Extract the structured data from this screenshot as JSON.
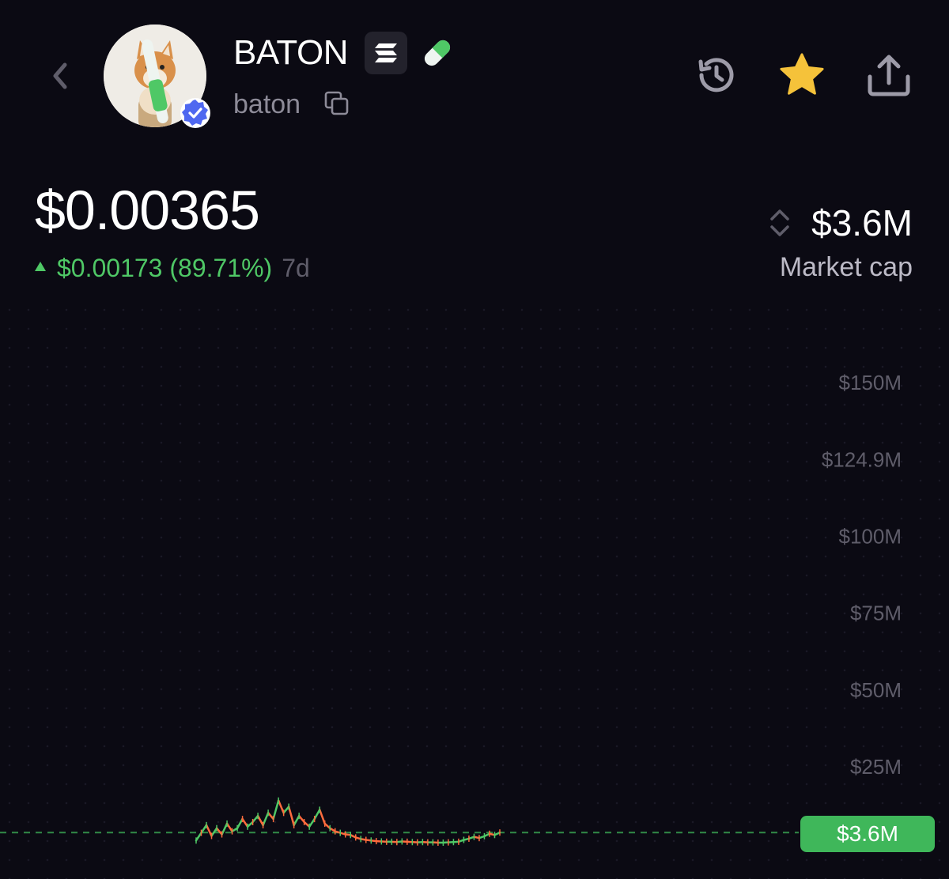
{
  "header": {
    "token_name": "BATON",
    "token_symbol": "baton",
    "icons": {
      "back": "chevron-left-icon",
      "chain": "solana-icon",
      "pill": "pill-icon",
      "copy": "copy-icon",
      "history": "history-icon",
      "watchlist": "star-icon",
      "share": "share-icon",
      "verified": "verified-badge-icon"
    },
    "watchlist_color": "#f5c23a"
  },
  "price": {
    "value": "$0.00365",
    "change": "$0.00173 (89.71%)",
    "period": "7d",
    "change_direction": "up",
    "change_color": "#4fc866"
  },
  "market_cap": {
    "value": "$3.6M",
    "label": "Market cap"
  },
  "chart": {
    "current_label": "$3.6M",
    "current_color": "#3fb75a"
  },
  "chart_data": {
    "type": "line",
    "title": "",
    "xlabel": "",
    "ylabel": "",
    "y_ticks": [
      "$150M",
      "$124.9M",
      "$100M",
      "$75M",
      "$50M",
      "$25M"
    ],
    "ylim": [
      0,
      150
    ],
    "y_unit": "M USD",
    "current_value": 3.6,
    "series": [
      {
        "values": [
          1,
          3.5,
          6,
          2.5,
          5,
          3,
          6.5,
          4,
          5,
          8,
          5.5,
          7,
          9,
          6,
          10,
          8,
          14,
          10,
          12,
          6,
          9,
          7,
          5.5,
          8,
          11,
          6.5,
          5,
          4,
          3.5,
          3,
          2.8,
          2,
          1.5,
          1.2,
          1,
          0.8,
          0.7,
          0.6,
          0.6,
          0.5,
          0.7,
          0.6,
          0.5,
          0.4,
          0.5,
          0.4,
          0.4,
          0.3,
          0.3,
          0.4,
          0.5,
          0.6,
          1.2,
          1.6,
          2.2,
          1.8,
          2.4,
          3.2,
          2.8,
          3.6
        ]
      }
    ],
    "grid": true,
    "axis_position": "right",
    "line_colors": [
      "#ff6b3d",
      "#4fc866"
    ]
  }
}
